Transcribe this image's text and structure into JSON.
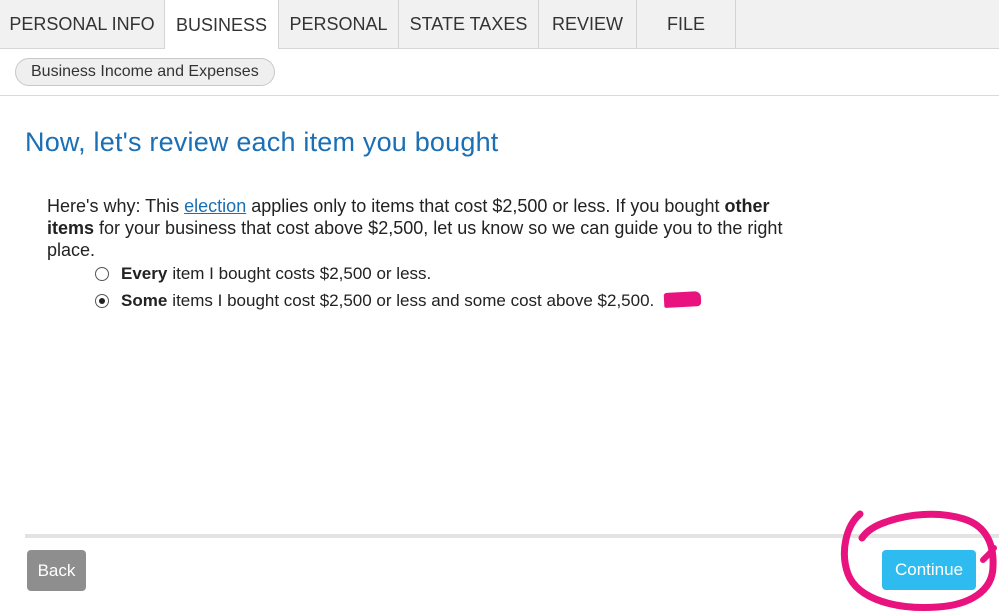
{
  "tabs": [
    {
      "label": "PERSONAL INFO",
      "active": false
    },
    {
      "label": "BUSINESS",
      "active": true
    },
    {
      "label": "PERSONAL",
      "active": false
    },
    {
      "label": "STATE TAXES",
      "active": false
    },
    {
      "label": "REVIEW",
      "active": false
    },
    {
      "label": "FILE",
      "active": false
    }
  ],
  "breadcrumb": {
    "label": "Business Income and Expenses"
  },
  "page": {
    "title": "Now, let's review each item you bought",
    "desc_part1": "Here's why: This ",
    "desc_link": "election",
    "desc_part2": " applies only to items that cost $2,500 or less. If you bought ",
    "desc_bold": "other items",
    "desc_part3": " for your business that cost above $2,500, let us know so we can guide you to the right place."
  },
  "options": [
    {
      "bold": "Every",
      "text": "item I bought costs $2,500 or less.",
      "selected": false
    },
    {
      "bold": "Some",
      "text": "items I bought cost $2,500 or less and some cost above $2,500.",
      "selected": true
    }
  ],
  "buttons": {
    "back": "Back",
    "continue": "Continue"
  },
  "colors": {
    "heading": "#1a6fb5",
    "continue": "#2ebcf0",
    "back": "#8e8e8e",
    "annotation": "#e8137e"
  }
}
